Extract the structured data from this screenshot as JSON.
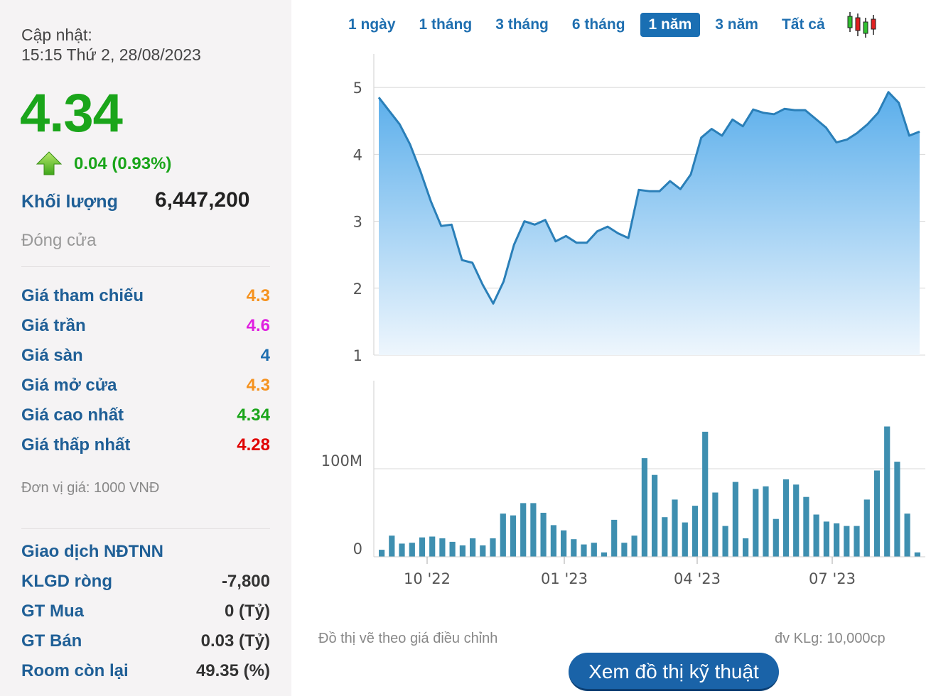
{
  "header": {
    "update_label": "Cập nhật:",
    "update_time": "15:15 Thứ 2, 28/08/2023",
    "price": "4.34",
    "change": "0.04 (0.93%)",
    "volume_label": "Khối lượng",
    "volume_value": "6,447,200",
    "status": "Đóng cửa"
  },
  "price_rows": [
    {
      "label": "Giá tham chiếu",
      "value": "4.3",
      "color": "#f5921e"
    },
    {
      "label": "Giá trần",
      "value": "4.6",
      "color": "#e01fe0"
    },
    {
      "label": "Giá sàn",
      "value": "4",
      "color": "#1f6fb0"
    },
    {
      "label": "Giá mở cửa",
      "value": "4.3",
      "color": "#f5921e"
    },
    {
      "label": "Giá cao nhất",
      "value": "4.34",
      "color": "#1aa51a"
    },
    {
      "label": "Giá thấp nhất",
      "value": "4.28",
      "color": "#e00000"
    }
  ],
  "unit_note": "Đơn vị giá: 1000 VNĐ",
  "foreign": {
    "title": "Giao dịch NĐTNN",
    "rows": [
      {
        "label": "KLGD ròng",
        "value": "-7,800"
      },
      {
        "label": "GT Mua",
        "value": "0 (Tỷ)"
      },
      {
        "label": "GT Bán",
        "value": "0.03 (Tỷ)"
      },
      {
        "label": "Room còn lại",
        "value": "49.35 (%)"
      }
    ]
  },
  "tabs": [
    "1 ngày",
    "1 tháng",
    "3 tháng",
    "6 tháng",
    "1 năm",
    "3 năm",
    "Tất cả"
  ],
  "active_tab": 4,
  "chart_data": [
    {
      "type": "area",
      "ylim": [
        1,
        5.5
      ],
      "yticks": [
        1,
        2,
        3,
        4,
        5
      ],
      "xticks": [
        "10 '22",
        "01 '23",
        "04 '23",
        "07 '23"
      ],
      "color": "#2a7fb8",
      "values": [
        4.85,
        4.65,
        4.45,
        4.15,
        3.75,
        3.3,
        2.93,
        2.95,
        2.42,
        2.38,
        2.05,
        1.77,
        2.1,
        2.65,
        3.0,
        2.95,
        3.02,
        2.7,
        2.78,
        2.68,
        2.68,
        2.85,
        2.92,
        2.82,
        2.75,
        3.47,
        3.45,
        3.45,
        3.6,
        3.48,
        3.7,
        4.25,
        4.38,
        4.28,
        4.52,
        4.42,
        4.67,
        4.62,
        4.6,
        4.68,
        4.66,
        4.66,
        4.53,
        4.4,
        4.18,
        4.22,
        4.32,
        4.45,
        4.62,
        4.93,
        4.77,
        4.28,
        4.34
      ]
    },
    {
      "type": "bar",
      "ylim": [
        0,
        200
      ],
      "yticks": [
        {
          "v": 0,
          "label": "0"
        },
        {
          "v": 100,
          "label": "100M"
        }
      ],
      "color": "#3e8fb0",
      "values": [
        8,
        24,
        15,
        16,
        22,
        23,
        21,
        17,
        13,
        21,
        13,
        21,
        49,
        47,
        61,
        61,
        50,
        36,
        30,
        20,
        14,
        16,
        5,
        42,
        16,
        24,
        112,
        93,
        45,
        65,
        39,
        58,
        142,
        73,
        35,
        85,
        21,
        77,
        80,
        43,
        88,
        82,
        68,
        48,
        40,
        38,
        35,
        35,
        65,
        98,
        148,
        108,
        49,
        5
      ]
    }
  ],
  "notes": {
    "adjusted": "Đồ thị vẽ theo giá điều chỉnh",
    "volume_unit": "đv KLg: 10,000cp"
  },
  "tech_button": "Xem đồ thị kỹ thuật"
}
